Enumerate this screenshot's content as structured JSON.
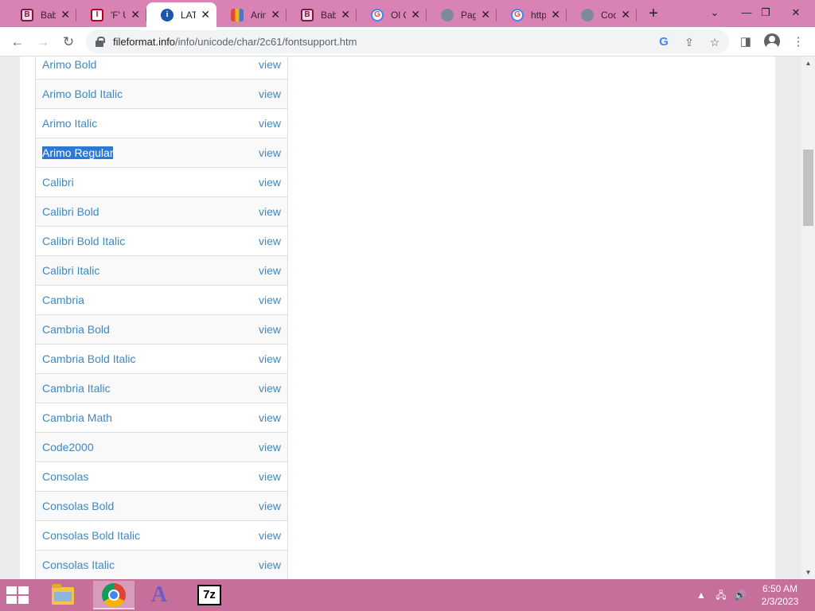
{
  "browser": {
    "tabs": [
      {
        "title": "Babu",
        "favicon": "babu-icon",
        "active": false
      },
      {
        "title": "'F' U",
        "favicon": "red-box-icon",
        "active": false
      },
      {
        "title": "LATI",
        "favicon": "info-icon",
        "active": true
      },
      {
        "title": "Arim",
        "favicon": "arimo-icon",
        "active": false
      },
      {
        "title": "Babu",
        "favicon": "babu-icon",
        "active": false
      },
      {
        "title": "Ol C",
        "favicon": "google-icon",
        "active": false
      },
      {
        "title": "Page",
        "favicon": "globe-icon",
        "active": false
      },
      {
        "title": "http",
        "favicon": "google-icon",
        "active": false
      },
      {
        "title": "Cod",
        "favicon": "globe-icon",
        "active": false
      }
    ],
    "url": {
      "host": "fileformat.info",
      "path": "/info/unicode/char/2c61/fontsupport.htm"
    }
  },
  "font_table": {
    "view_label": "view",
    "rows": [
      {
        "name": "Arimo Bold",
        "highlighted": false
      },
      {
        "name": "Arimo Bold Italic",
        "highlighted": false
      },
      {
        "name": "Arimo Italic",
        "highlighted": false
      },
      {
        "name": "Arimo Regular",
        "highlighted": true
      },
      {
        "name": "Calibri",
        "highlighted": false
      },
      {
        "name": "Calibri Bold",
        "highlighted": false
      },
      {
        "name": "Calibri Bold Italic",
        "highlighted": false
      },
      {
        "name": "Calibri Italic",
        "highlighted": false
      },
      {
        "name": "Cambria",
        "highlighted": false
      },
      {
        "name": "Cambria Bold",
        "highlighted": false
      },
      {
        "name": "Cambria Bold Italic",
        "highlighted": false
      },
      {
        "name": "Cambria Italic",
        "highlighted": false
      },
      {
        "name": "Cambria Math",
        "highlighted": false
      },
      {
        "name": "Code2000",
        "highlighted": false
      },
      {
        "name": "Consolas",
        "highlighted": false
      },
      {
        "name": "Consolas Bold",
        "highlighted": false
      },
      {
        "name": "Consolas Bold Italic",
        "highlighted": false
      },
      {
        "name": "Consolas Italic",
        "highlighted": false
      }
    ]
  },
  "taskbar": {
    "apps": [
      "file-explorer-icon",
      "chrome-icon",
      "font-app-icon",
      "7zip-icon"
    ],
    "sevenzip_label": "7z",
    "font_app_label": "A",
    "clock": {
      "time": "6:50 AM",
      "date": "2/3/2023"
    }
  },
  "colors": {
    "tabstrip": "#d983b4",
    "taskbar": "#c76f9b",
    "link": "#3f88c0",
    "selection": "#2b79d6"
  }
}
